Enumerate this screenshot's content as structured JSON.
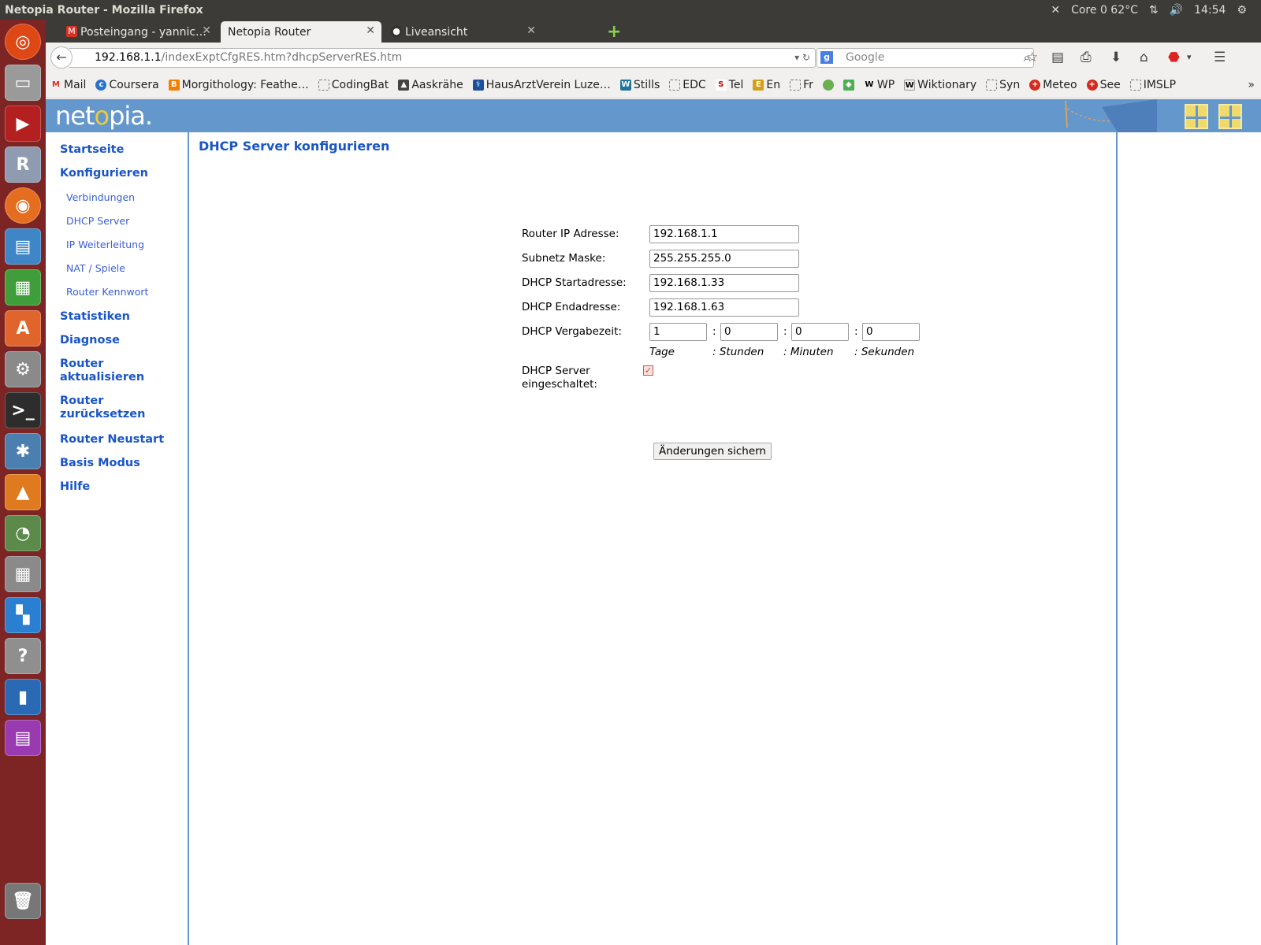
{
  "system": {
    "window_title": "Netopia Router - Mozilla Firefox",
    "cpu_temp": "Core 0 62°C",
    "clock": "14:54"
  },
  "browser": {
    "tabs": [
      {
        "label": "Posteingang - yannic…",
        "icon": "gmail-icon"
      },
      {
        "label": "Netopia Router",
        "icon": "page-icon"
      },
      {
        "label": "Liveansicht",
        "icon": "camera-icon"
      }
    ],
    "url_host": "192.168.1.1",
    "url_path": "/indexExptCfgRES.htm?dhcpServerRES.htm",
    "search_placeholder": "Google",
    "bookmarks": [
      "Mail",
      "Coursera",
      "Morgithology: Feathe…",
      "CodingBat",
      "Aaskrähe",
      "HausArztVerein Luze…",
      "Stills",
      "EDC",
      "Tel",
      "En",
      "Fr",
      "",
      "",
      "WP",
      "Wiktionary",
      "Syn",
      "Meteo",
      "See",
      "IMSLP"
    ],
    "bookmarks_more": "»"
  },
  "router": {
    "logo": {
      "pre": "net",
      "dot": "o",
      "post": "pia."
    },
    "nav": {
      "startseite": "Startseite",
      "konfigurieren": "Konfigurieren",
      "verbindungen": "Verbindungen",
      "dhcp_server": "DHCP Server",
      "ip_weiterleitung": "IP Weiterleitung",
      "nat_spiele": "NAT / Spiele",
      "router_kennwort": "Router Kennwort",
      "statistiken": "Statistiken",
      "diagnose": "Diagnose",
      "router_aktualisieren_1": "Router",
      "router_aktualisieren_2": "aktualisieren",
      "router_zuruecksetzen_1": "Router",
      "router_zuruecksetzen_2": "zurücksetzen",
      "router_neustart": "Router Neustart",
      "basis_modus": "Basis Modus",
      "hilfe": "Hilfe"
    },
    "page_title": "DHCP Server konfigurieren",
    "form": {
      "router_ip_label": "Router IP Adresse:",
      "router_ip_value": "192.168.1.1",
      "subnet_label": "Subnetz Maske:",
      "subnet_value": "255.255.255.0",
      "start_label": "DHCP Startadresse:",
      "start_value": "192.168.1.33",
      "end_label": "DHCP Endadresse:",
      "end_value": "192.168.1.63",
      "lease_label": "DHCP Vergabezeit:",
      "lease_days": "1",
      "lease_hours": "0",
      "lease_minutes": "0",
      "lease_seconds": "0",
      "colon": ":",
      "unit_days": "Tage",
      "unit_hours": ": Stunden",
      "unit_minutes": ": Minuten",
      "unit_seconds": ": Sekunden",
      "enabled_label_1": "DHCP Server",
      "enabled_label_2": "eingeschaltet:",
      "enabled": true,
      "save_label": "Änderungen sichern"
    }
  }
}
